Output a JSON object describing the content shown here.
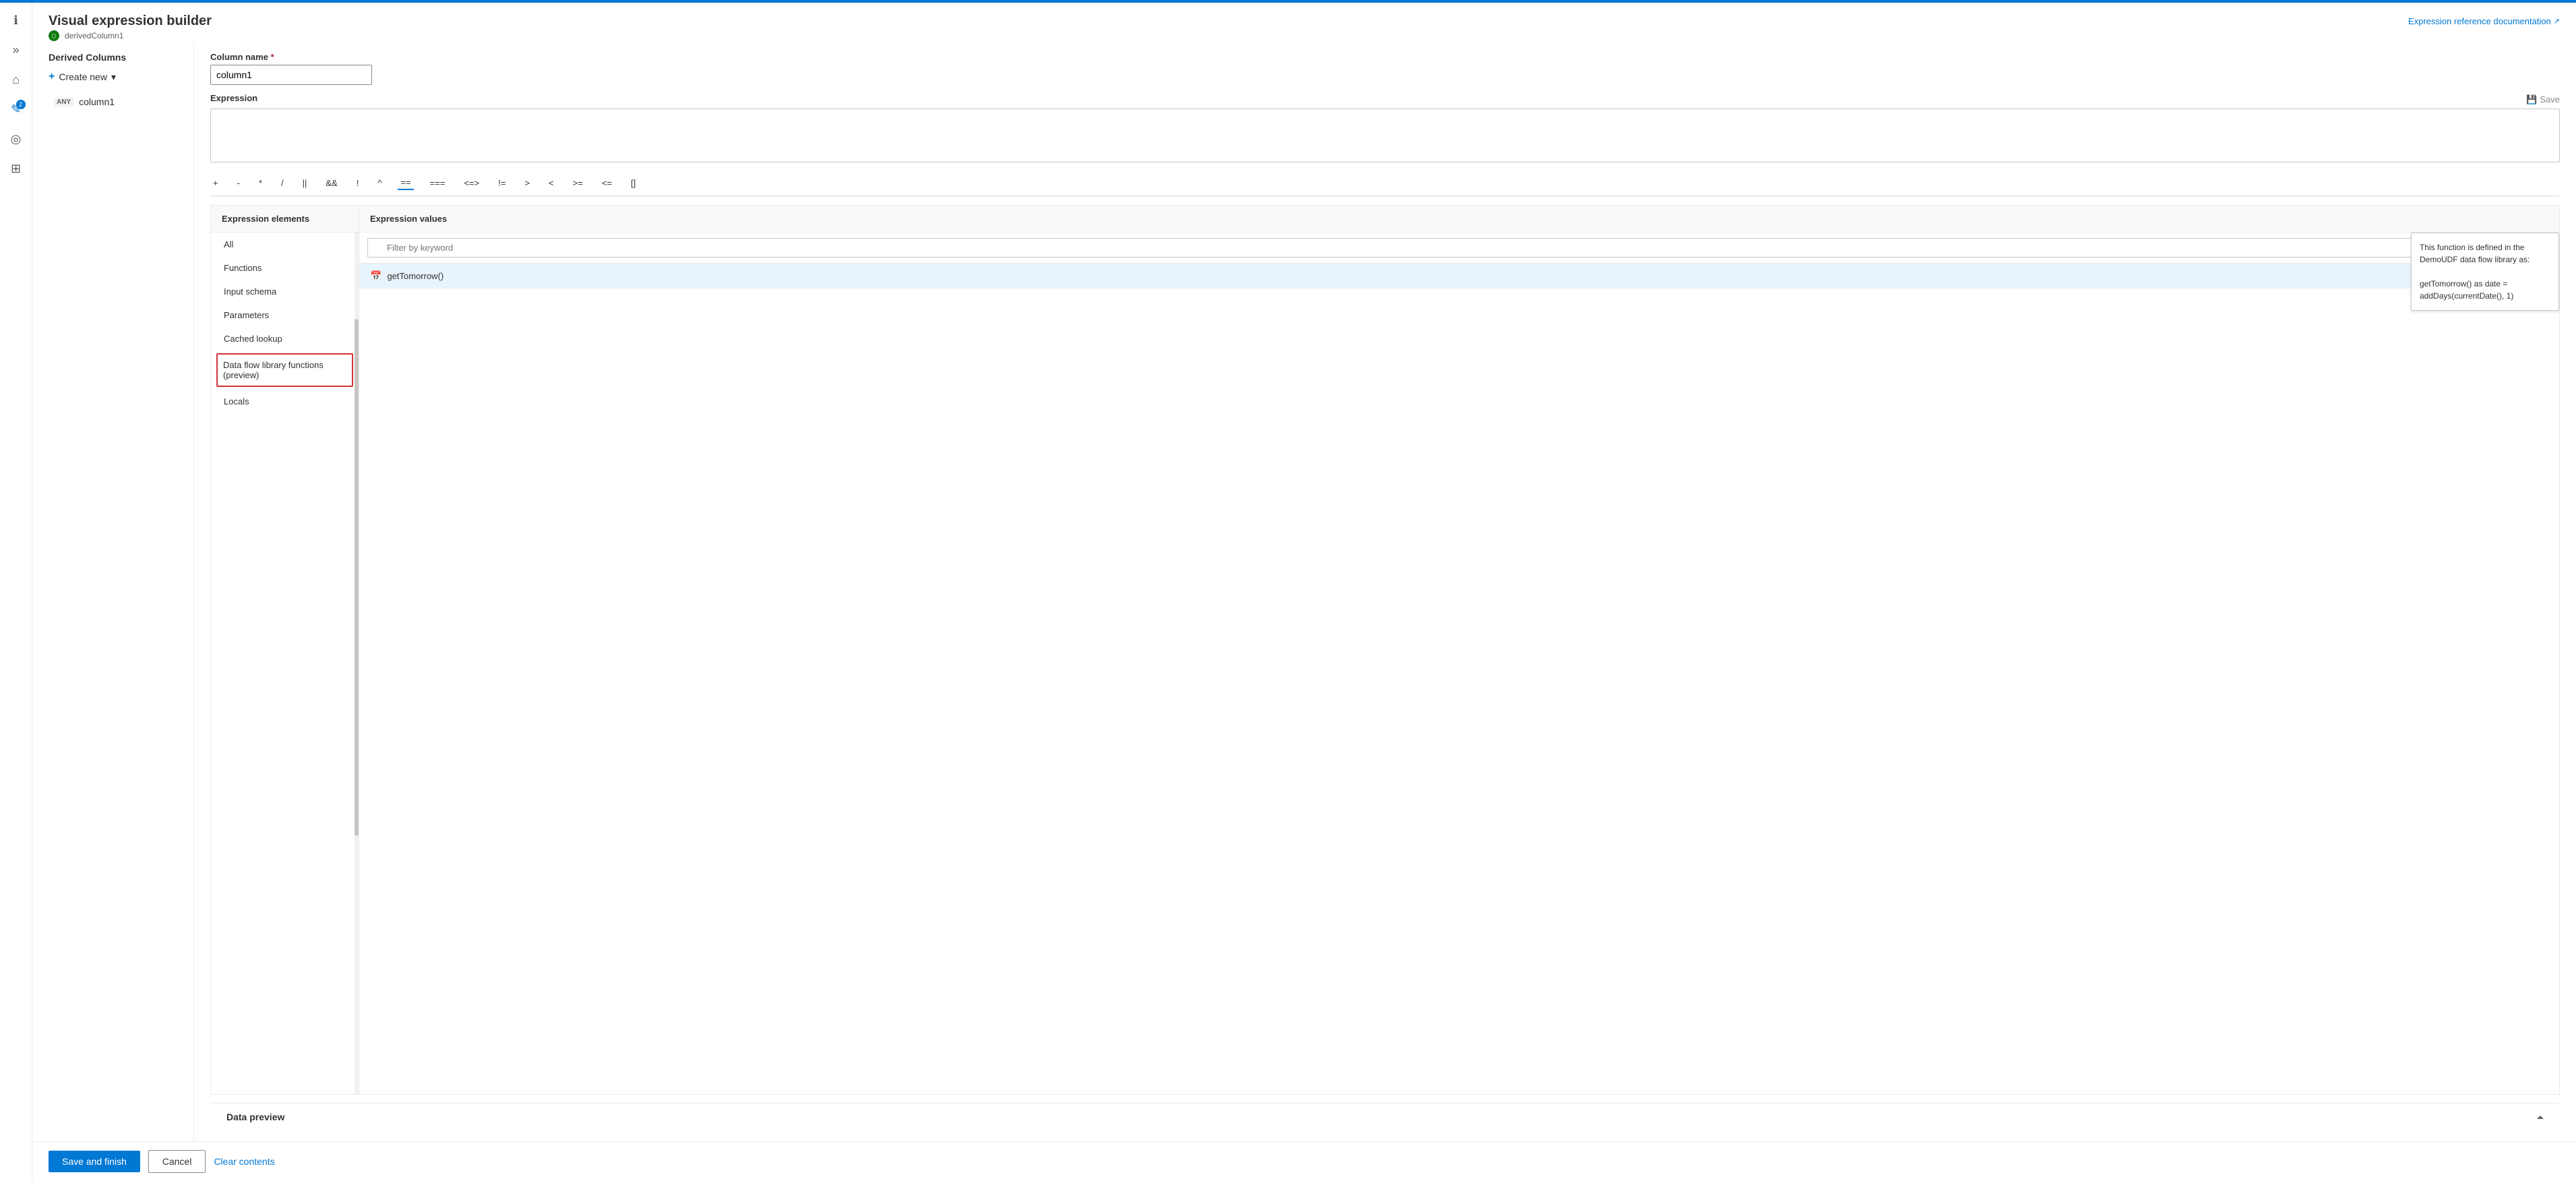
{
  "app": {
    "title": "Visual expression builder",
    "breadcrumb": "derivedColumn1",
    "expr_ref_link": "Expression reference documentation"
  },
  "nav": {
    "items": [
      {
        "id": "info",
        "icon": "ℹ",
        "active": false
      },
      {
        "id": "expand",
        "icon": "»",
        "active": false
      },
      {
        "id": "home",
        "icon": "⌂",
        "active": false
      },
      {
        "id": "edit",
        "icon": "✎",
        "active": true,
        "badge": "2"
      },
      {
        "id": "monitor",
        "icon": "◎",
        "active": false
      },
      {
        "id": "briefcase",
        "icon": "⊞",
        "active": false
      }
    ]
  },
  "sidebar": {
    "section_title": "Derived Columns",
    "create_new_label": "Create new",
    "columns": [
      {
        "name": "column1",
        "type": "ANY"
      }
    ]
  },
  "column_name_field": {
    "label": "Column name",
    "required": true,
    "value": "column1",
    "placeholder": "column1"
  },
  "expression_field": {
    "label": "Expression",
    "save_label": "Save",
    "value": ""
  },
  "operators": [
    "+",
    "-",
    "*",
    "/",
    "||",
    "&&",
    "!",
    "^",
    "==",
    "===",
    "<=>",
    "!=",
    ">",
    "<",
    ">=",
    "<=",
    "[]"
  ],
  "expression_elements": {
    "section_title": "Expression elements",
    "items": [
      {
        "id": "all",
        "label": "All"
      },
      {
        "id": "functions",
        "label": "Functions"
      },
      {
        "id": "input-schema",
        "label": "Input schema"
      },
      {
        "id": "parameters",
        "label": "Parameters"
      },
      {
        "id": "cached-lookup",
        "label": "Cached lookup"
      },
      {
        "id": "data-flow-library",
        "label": "Data flow library functions\n(preview)",
        "highlighted": true
      },
      {
        "id": "locals",
        "label": "Locals"
      }
    ]
  },
  "expression_values": {
    "section_title": "Expression values",
    "filter_placeholder": "Filter by keyword",
    "items": [
      {
        "id": "getTomorrow",
        "label": "getTomorrow()",
        "icon": "📅"
      }
    ]
  },
  "function_tooltip": {
    "text": "This function is defined in the DemoUDF data flow library as:\n\ngetTomorrow() as date = addDays(currentDate(), 1)"
  },
  "data_preview": {
    "title": "Data preview"
  },
  "footer": {
    "save_finish_label": "Save and finish",
    "cancel_label": "Cancel",
    "clear_contents_label": "Clear contents"
  }
}
